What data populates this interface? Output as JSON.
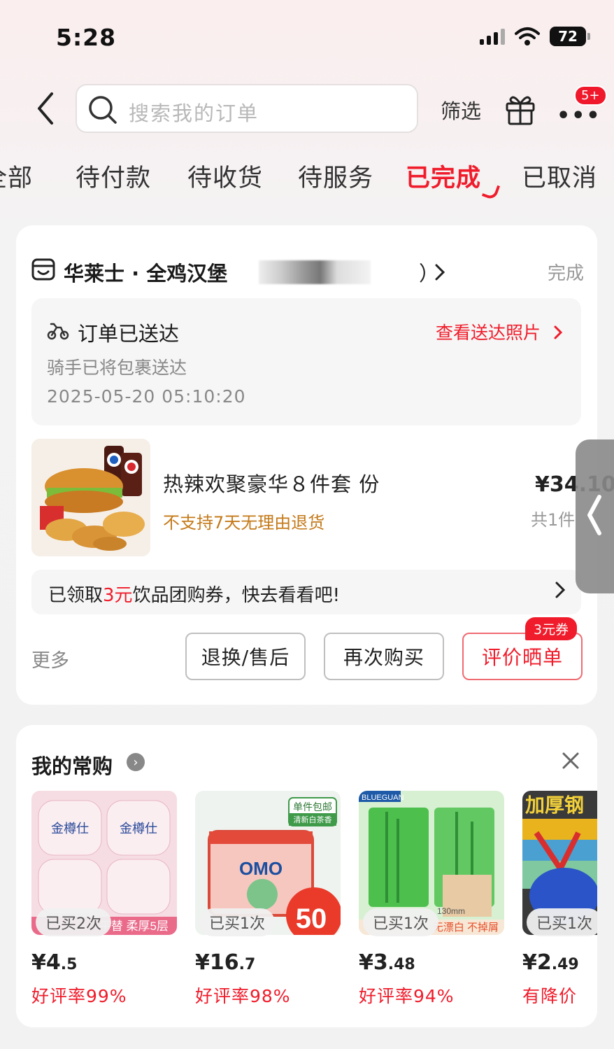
{
  "status_bar": {
    "time": "5:28",
    "battery": "72"
  },
  "search": {
    "placeholder": "搜索我的订单",
    "filter_label": "筛选",
    "badge": "5+"
  },
  "tabs": [
    {
      "label": "全部",
      "active": false
    },
    {
      "label": "待付款",
      "active": false
    },
    {
      "label": "待收货",
      "active": false
    },
    {
      "label": "待服务",
      "active": false
    },
    {
      "label": "已完成",
      "active": true
    },
    {
      "label": "已取消",
      "active": false
    }
  ],
  "order": {
    "store_name": "华莱士 · 全鸡汉堡",
    "store_suffix": "）",
    "status": "完成",
    "delivery": {
      "title": "订单已送达",
      "link": "查看送达照片",
      "subtitle": "骑手已将包裹送达",
      "time": "2025-05-20 05:10:20"
    },
    "product": {
      "name": "热辣欢聚豪华８件套 份",
      "note": "不支持7天无理由退货",
      "price": "¥34.10",
      "count": "共1件"
    },
    "coupon_bar": {
      "prefix": "已领取",
      "amount": "3元",
      "suffix": "饮品团购券，快去看看吧!"
    },
    "more": "更多",
    "buttons": {
      "after_sales": "退换/售后",
      "rebuy": "再次购买",
      "review": "评价晒单"
    },
    "review_coupon": "3元券"
  },
  "frequent": {
    "title": "我的常购",
    "info_icon": "›",
    "items": [
      {
        "bought": "已买2次",
        "price_sym": "¥",
        "price_int": "4",
        "price_dec": ".5",
        "rate": "好评率99%",
        "theme": "#f3cfd8"
      },
      {
        "bought": "已买1次",
        "price_sym": "¥",
        "price_int": "16",
        "price_dec": ".7",
        "rate": "好评率98%",
        "theme": "#e7f1ea"
      },
      {
        "bought": "已买1次",
        "price_sym": "¥",
        "price_int": "3",
        "price_dec": ".48",
        "rate": "好评率94%",
        "theme": "#c9ecc3"
      },
      {
        "bought": "已买1次",
        "price_sym": "¥",
        "price_int": "2",
        "price_dec": ".49",
        "rate": "有降价",
        "theme": "#2d5fa8"
      }
    ]
  },
  "image_text": {
    "brand1": "金樽仕",
    "strip1": "平替 柔厚5层",
    "tag2a": "单件包邮",
    "tag2b": "清新白茶香",
    "brand2": "OMO",
    "big2": "50",
    "brand3": "BLUEGUAN",
    "strip3": "无漂白 不掉屑",
    "size3": "130mm",
    "title4": "加厚钢"
  },
  "colors": {
    "accent": "#f01c2b",
    "note": "#c47a1a"
  }
}
